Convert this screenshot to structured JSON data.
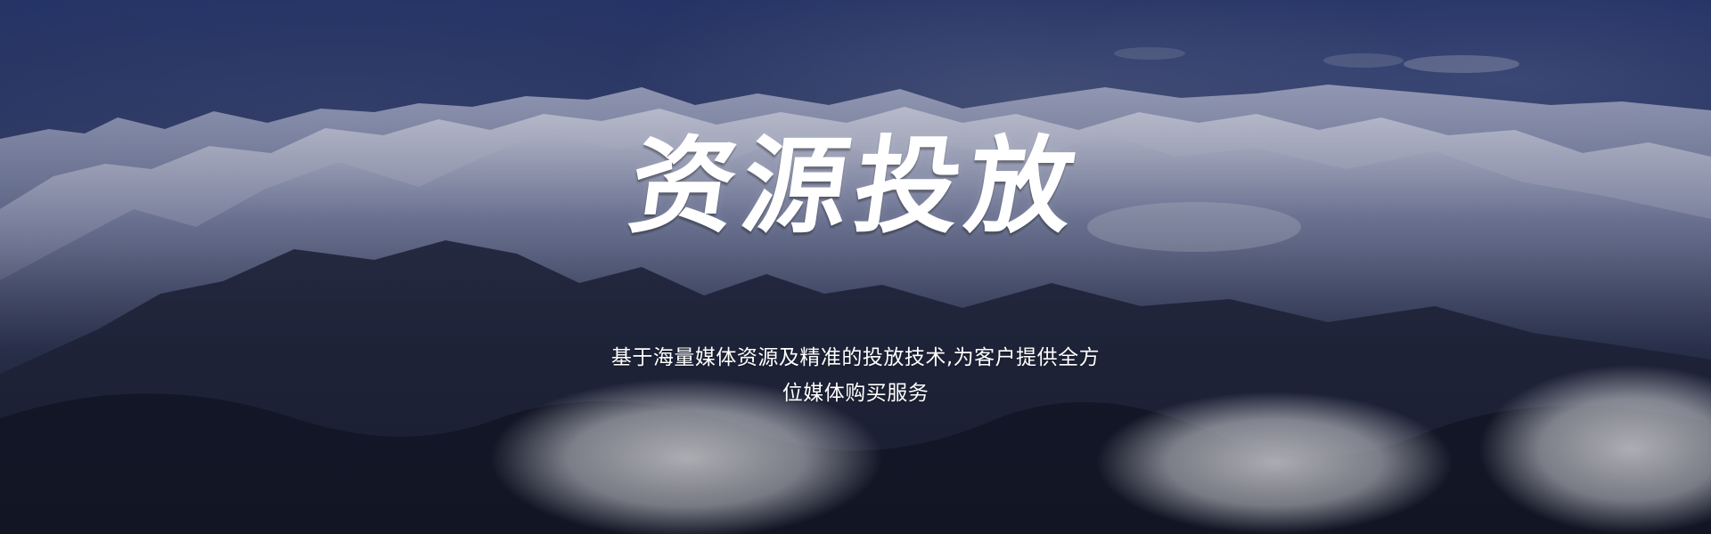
{
  "hero": {
    "title": "资源投放",
    "subtitle_line_1": "基于海量媒体资源及精准的投放技术,为客户提供全方",
    "subtitle_line_2": "位媒体购买服务"
  },
  "colors": {
    "sky_top": "#24366f",
    "overlay": "#1f2947",
    "text": "#ffffff"
  }
}
